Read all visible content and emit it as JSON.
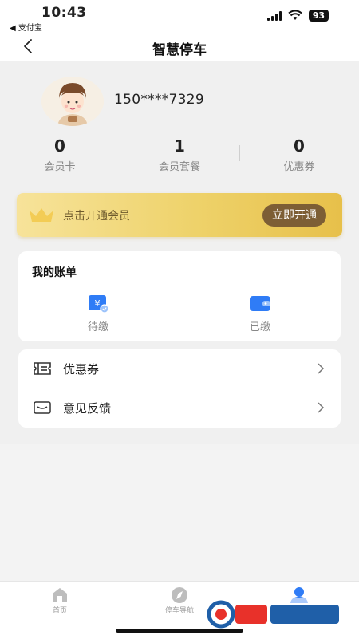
{
  "status_bar": {
    "time": "10:43",
    "back_app": "◀ 支付宝",
    "battery": "93"
  },
  "nav": {
    "title": "智慧停车"
  },
  "profile": {
    "phone": "150****7329"
  },
  "stats": [
    {
      "value": "0",
      "label": "会员卡"
    },
    {
      "value": "1",
      "label": "会员套餐"
    },
    {
      "value": "0",
      "label": "优惠券"
    }
  ],
  "vip": {
    "text": "点击开通会员",
    "button": "立即开通"
  },
  "bill": {
    "title": "我的账单",
    "items": [
      {
        "label": "待缴",
        "icon": "pending-payment-icon"
      },
      {
        "label": "已缴",
        "icon": "wallet-icon"
      }
    ]
  },
  "menu": {
    "items": [
      {
        "label": "优惠券",
        "icon": "coupon-icon"
      },
      {
        "label": "意见反馈",
        "icon": "feedback-icon"
      }
    ]
  },
  "tabs": [
    {
      "label": "首页",
      "icon": "home-icon"
    },
    {
      "label": "停车导航",
      "icon": "compass-icon"
    },
    {
      "label": "",
      "icon": "user-icon"
    }
  ],
  "colors": {
    "accent_blue": "#2f7cf6",
    "vip_button": "#7d5e35",
    "vip_gold": "#eed26a"
  }
}
